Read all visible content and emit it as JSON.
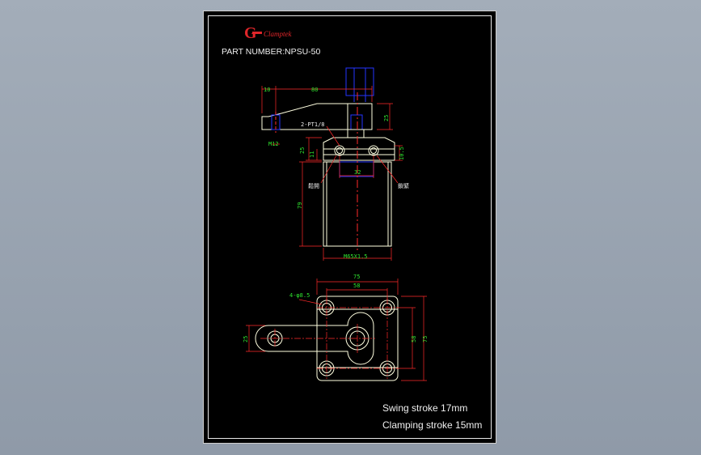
{
  "logo": {
    "brand_text": "Clamptek",
    "accent_color": "#e0262a"
  },
  "part_number": {
    "label": "PART NUMBER:",
    "value": "NPSU-50"
  },
  "side_view": {
    "dims": {
      "d10": "10",
      "d80": "80",
      "d25_right": "25",
      "m12": "M12",
      "d25_left": "25",
      "d11": "11",
      "d10_5": "10.5",
      "d32": "32",
      "d79": "79",
      "thread": "M65X1.5"
    },
    "port_label": "2-PT1/8",
    "side_note_left": "鬆開",
    "side_note_right": "鎖緊"
  },
  "top_view": {
    "dims": {
      "d75_top": "75",
      "d58": "58",
      "holes": "4-φ8.5",
      "d25": "25",
      "d58_side": "58",
      "d75_side": "75"
    }
  },
  "specs": {
    "swing_stroke": "Swing stroke 17mm",
    "clamping_stroke": "Clamping stroke 15mm"
  },
  "colors": {
    "sheet": "#000000",
    "outline": "#ffffe0",
    "dimension": "#2fe32f",
    "hidden": "#2535ff",
    "center": "#ff2a2a",
    "leader": "#ff2a2a"
  }
}
